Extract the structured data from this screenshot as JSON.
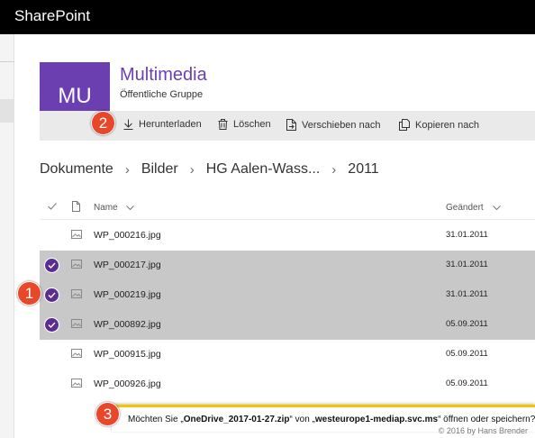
{
  "suitebar": {
    "title": "SharePoint"
  },
  "site": {
    "tile_initials": "MU",
    "title": "Multimedia",
    "subtitle": "Öffentliche Gruppe"
  },
  "commands": [
    {
      "label": "Herunterladen",
      "icon": "download-icon"
    },
    {
      "label": "Löschen",
      "icon": "trash-icon"
    },
    {
      "label": "Verschieben nach",
      "icon": "move-to-icon"
    },
    {
      "label": "Kopieren nach",
      "icon": "copy-to-icon"
    }
  ],
  "breadcrumb": [
    "Dokumente",
    "Bilder",
    "HG Aalen-Wass...",
    "2011"
  ],
  "columns": {
    "name": "Name",
    "modified": "Geändert"
  },
  "files": [
    {
      "name": "WP_000216.jpg",
      "modified": "31.01.2011",
      "selected": false
    },
    {
      "name": "WP_000217.jpg",
      "modified": "31.01.2011",
      "selected": true
    },
    {
      "name": "WP_000219.jpg",
      "modified": "31.01.2011",
      "selected": true
    },
    {
      "name": "WP_000892.jpg",
      "modified": "05.09.2011",
      "selected": true
    },
    {
      "name": "WP_000915.jpg",
      "modified": "05.09.2011",
      "selected": false
    },
    {
      "name": "WP_000926.jpg",
      "modified": "05.09.2011",
      "selected": false
    }
  ],
  "badges": [
    "1",
    "2",
    "3"
  ],
  "download_prompt": {
    "prefix": "Möchten Sie „",
    "file": "OneDrive_2017-01-27.zip",
    "middle": "“ von „",
    "host": "westeurope1-mediap.svc.ms",
    "suffix": "“ öffnen oder speichern?"
  },
  "copyright": "© 2016 by Hans Brender",
  "colors": {
    "accent": "#6b3fb0",
    "badge": "#e8472a",
    "notification": "#f3c500",
    "selected_row": "#c8c8c8"
  }
}
